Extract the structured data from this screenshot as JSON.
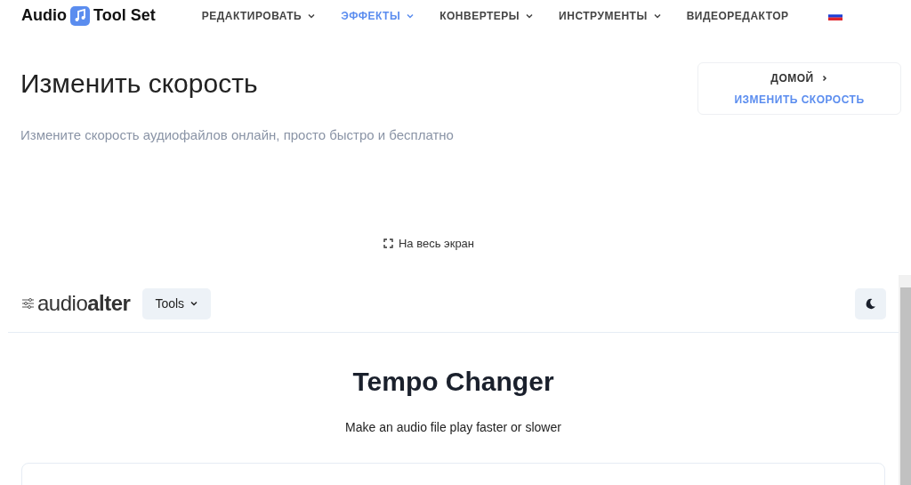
{
  "header": {
    "logo_left": "Audio",
    "logo_right": "Tool Set",
    "nav": [
      {
        "label": "РЕДАКТИРОВАТЬ",
        "kind": "dropdown",
        "selected": false
      },
      {
        "label": "ЭФФЕКТЫ",
        "kind": "dropdown",
        "selected": true
      },
      {
        "label": "КОНВЕРТЕРЫ",
        "kind": "dropdown",
        "selected": false
      },
      {
        "label": "ИНСТРУМЕНТЫ",
        "kind": "dropdown",
        "selected": false
      },
      {
        "label": "ВИДЕОРЕДАКТОР",
        "kind": "link",
        "selected": false
      }
    ]
  },
  "page": {
    "title": "Изменить скорость",
    "subtitle": "Измените скорость аудиофайлов онлайн, просто быстро и бесплатно",
    "breadcrumb": [
      {
        "label": "ДОМОЙ",
        "selected": false
      },
      {
        "label": "ИЗМЕНИТЬ СКОРОСТЬ",
        "selected": true
      }
    ],
    "fullscreen": "На весь экран"
  },
  "embed": {
    "logo_left": "audio",
    "logo_right": "alter",
    "tools_button": "Tools",
    "title": "Tempo Changer",
    "subtitle": "Make an audio file play faster or slower"
  }
}
